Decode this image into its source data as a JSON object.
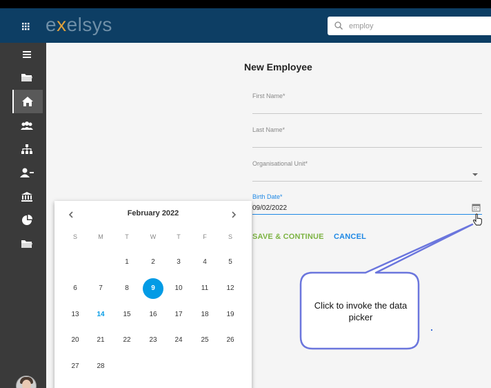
{
  "app": {
    "logo_prefix": "e",
    "logo_x": "x",
    "logo_suffix": "elsys"
  },
  "search": {
    "value": "employ",
    "placeholder": "Search"
  },
  "sidebar": {
    "items": [
      {
        "icon": "menu-icon"
      },
      {
        "icon": "folder-icon"
      },
      {
        "icon": "home-icon",
        "active": true
      },
      {
        "icon": "users-icon"
      },
      {
        "icon": "org-chart-icon"
      },
      {
        "icon": "remove-user-icon"
      },
      {
        "icon": "bank-icon"
      },
      {
        "icon": "pie-chart-icon"
      },
      {
        "icon": "folder-open-icon"
      }
    ]
  },
  "form": {
    "title": "New Employee",
    "first_name_label": "First Name*",
    "last_name_label": "Last Name*",
    "org_unit_label": "Organisational Unit*",
    "birth_date_label": "Birth Date*",
    "birth_date_value": "09/02/2022",
    "save_label": "SAVE & CONTINUE",
    "cancel_label": "CANCEL"
  },
  "datepicker": {
    "month_label": "February 2022",
    "weekdays": [
      "S",
      "M",
      "T",
      "W",
      "T",
      "F",
      "S"
    ],
    "weeks": [
      [
        "",
        "",
        "1",
        "2",
        "3",
        "4",
        "5"
      ],
      [
        "6",
        "7",
        "8",
        "9",
        "10",
        "11",
        "12"
      ],
      [
        "13",
        "14",
        "15",
        "16",
        "17",
        "18",
        "19"
      ],
      [
        "20",
        "21",
        "22",
        "23",
        "24",
        "25",
        "26"
      ],
      [
        "27",
        "28",
        "",
        "",
        "",
        "",
        ""
      ]
    ],
    "selected": "9",
    "today": "14"
  },
  "callout": {
    "text": "Click to invoke the data picker"
  },
  "colors": {
    "topbar": "#0d3e64",
    "sidebar": "#3a3a3a",
    "accent": "#039be5",
    "save": "#7cb342",
    "cancel": "#1e88e5",
    "callout_border": "#6b76dd"
  }
}
